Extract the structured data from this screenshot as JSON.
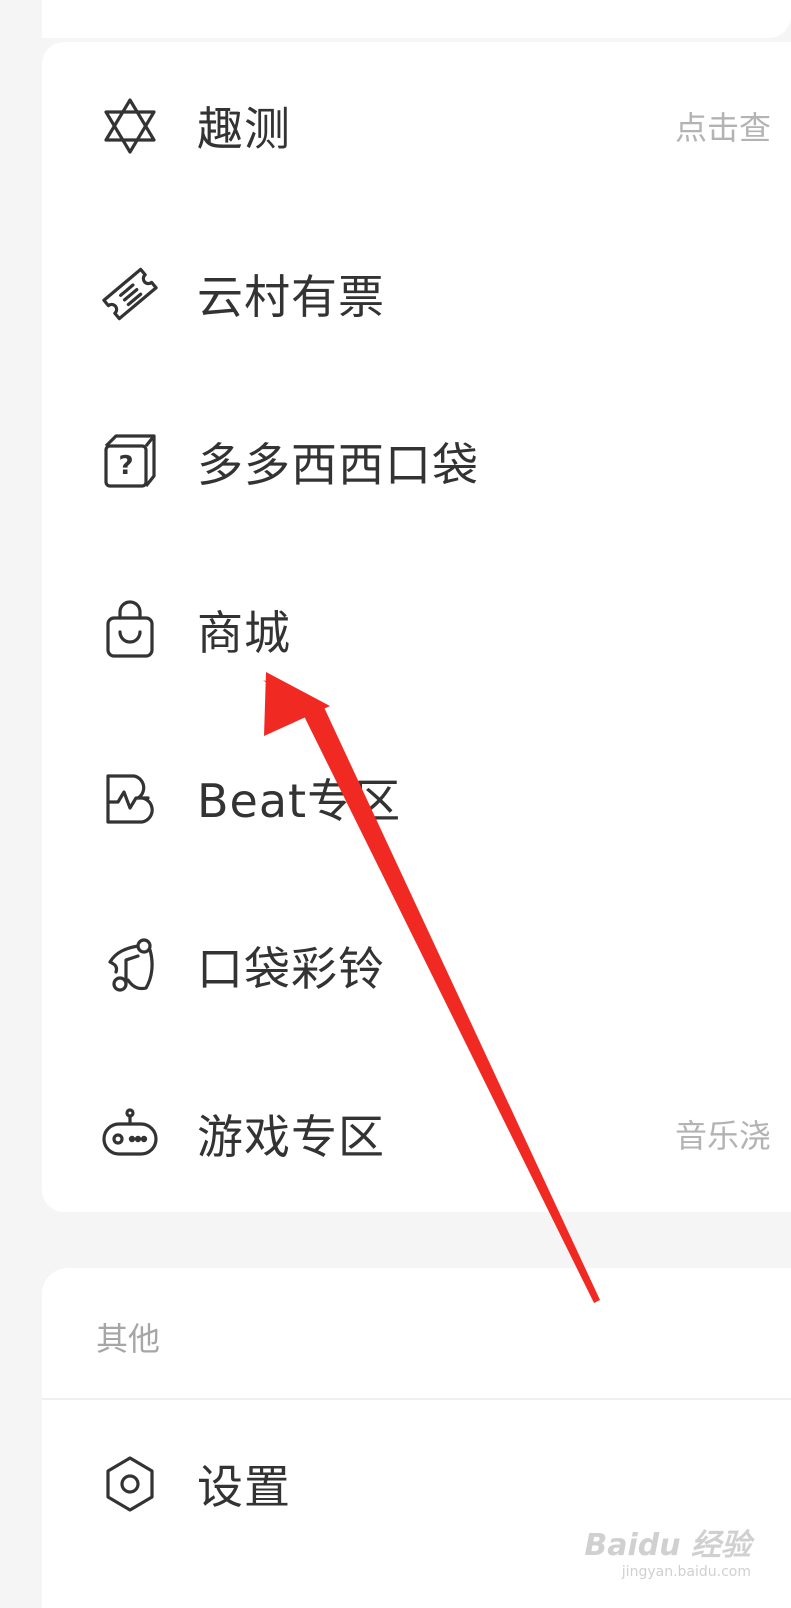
{
  "menu": {
    "items": [
      {
        "label": "趣测",
        "subtext": "点击查",
        "icon": "star-of-david-icon"
      },
      {
        "label": "云村有票",
        "subtext": "",
        "icon": "ticket-icon"
      },
      {
        "label": "多多西西口袋",
        "subtext": "",
        "icon": "mystery-box-icon"
      },
      {
        "label": "商城",
        "subtext": "",
        "icon": "shopping-bag-icon"
      },
      {
        "label": "Beat专区",
        "subtext": "",
        "icon": "beat-pulse-icon"
      },
      {
        "label": "口袋彩铃",
        "subtext": "",
        "icon": "ringtone-icon"
      },
      {
        "label": "游戏专区",
        "subtext": "音乐浇",
        "icon": "gamepad-icon"
      }
    ]
  },
  "other": {
    "title": "其他",
    "items": [
      {
        "label": "设置",
        "icon": "hexagon-settings-icon"
      }
    ]
  },
  "watermark": {
    "brand": "Baidu 经验",
    "url": "jingyan.baidu.com"
  },
  "colors": {
    "background": "#f5f5f5",
    "card": "#ffffff",
    "label": "#333333",
    "subtext": "#b3b3b3",
    "annotation_arrow": "#f02a23"
  }
}
